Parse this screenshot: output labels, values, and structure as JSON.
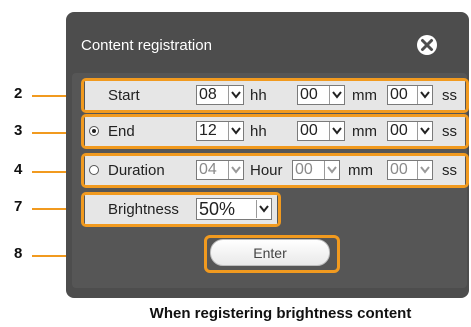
{
  "dialog": {
    "title": "Content registration",
    "close_icon": "close-circle-icon"
  },
  "rows": {
    "start": {
      "label": "Start",
      "h": "08",
      "h_unit": "hh",
      "m": "00",
      "m_unit": "mm",
      "s": "00",
      "s_unit": "ss"
    },
    "end": {
      "label": "End",
      "h": "12",
      "h_unit": "hh",
      "m": "00",
      "m_unit": "mm",
      "s": "00",
      "s_unit": "ss",
      "selected": true
    },
    "duration": {
      "label": "Duration",
      "h": "04",
      "h_unit": "Hour",
      "m": "00",
      "m_unit": "mm",
      "s": "00",
      "s_unit": "ss",
      "selected": false
    },
    "brightness": {
      "label": "Brightness",
      "value": "50%"
    }
  },
  "enter_button": "Enter",
  "callouts": [
    "2",
    "3",
    "4",
    "7",
    "8"
  ],
  "caption": "When registering brightness content",
  "colors": {
    "dialog_bg": "#4d4d4d",
    "highlight": "#f19a1f",
    "row_bg": "#e6e6e6"
  }
}
